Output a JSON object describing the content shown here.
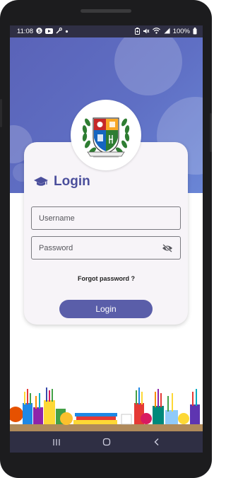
{
  "status_bar": {
    "time": "11:08",
    "battery": "100%",
    "icons_left": [
      "s-badge-icon",
      "youtube-icon",
      "tools-icon",
      "dot-icon"
    ],
    "icons_right": [
      "battery-saver-icon",
      "mute-icon",
      "wifi-icon",
      "signal-icon",
      "battery-icon"
    ]
  },
  "login": {
    "title": "Login",
    "title_icon": "graduation-cap-icon",
    "username_placeholder": "Username",
    "password_placeholder": "Password",
    "forgot_label": "Forgot password ?",
    "submit_label": "Login"
  },
  "nav": {
    "buttons": [
      "recent-apps-icon",
      "home-icon",
      "back-icon"
    ]
  },
  "colors": {
    "accent": "#5a5ea9",
    "title": "#4b4f9c",
    "hero_start": "#5a63b8",
    "hero_end": "#6a86d6",
    "card": "#f7f4f8",
    "bars": "#2f2f44"
  }
}
